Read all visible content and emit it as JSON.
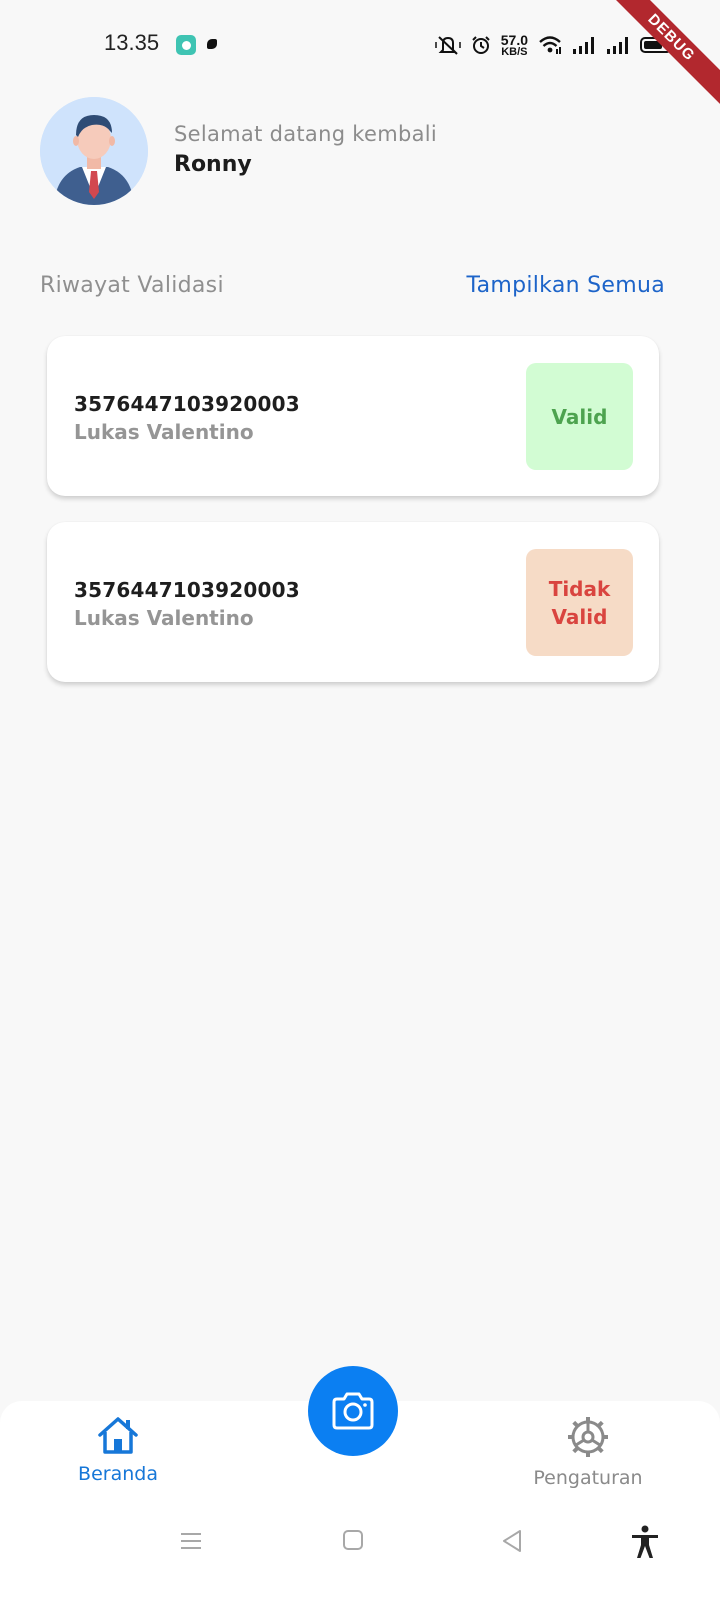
{
  "status_bar": {
    "time": "13.35",
    "network_speed_value": "57.0",
    "network_speed_unit": "KB/S",
    "icons": [
      "chat-app-icon",
      "notification-icon",
      "mute-icon",
      "alarm-icon",
      "wifi-icon",
      "signal-icon",
      "signal-icon",
      "battery-icon"
    ]
  },
  "debug_ribbon": "DEBUG",
  "header": {
    "greeting": "Selamat datang kembali",
    "username": "Ronny"
  },
  "section": {
    "title": "Riwayat Validasi",
    "show_all": "Tampilkan Semua"
  },
  "records": [
    {
      "id_number": "3576447103920003",
      "name": "Lukas Valentino",
      "status": "Valid"
    },
    {
      "id_number": "3576447103920003",
      "name": "Lukas Valentino",
      "status": "Tidak Valid"
    }
  ],
  "bottom_nav": {
    "home_label": "Beranda",
    "settings_label": "Pengaturan"
  },
  "colors": {
    "primary": "#0b7ff2",
    "link": "#1d64c9",
    "valid_bg": "#d2fcd3",
    "valid_text": "#4da34f",
    "invalid_bg": "#f6dbc6",
    "invalid_text": "#d9443f"
  }
}
